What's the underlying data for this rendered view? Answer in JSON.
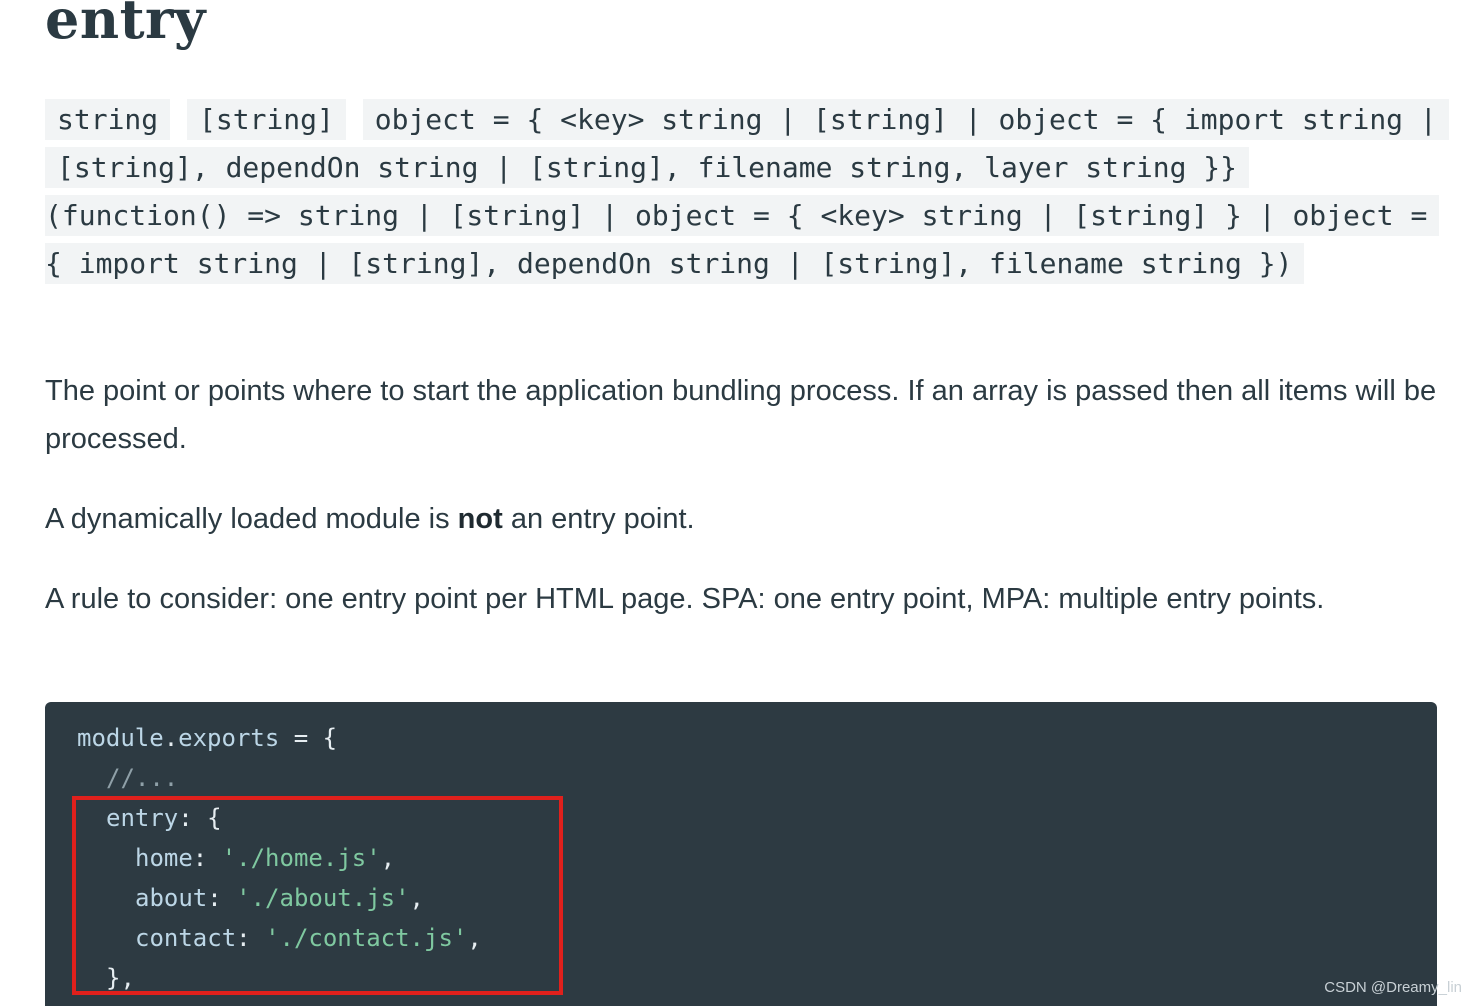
{
  "heading": "entry",
  "type_signature": {
    "t1": "string",
    "t2": "[string]",
    "t3": "object = { <key> string | [string] | object = { import string | [string], dependOn string | [string], filename string, layer string }}",
    "t4": "(function() => string | [string] | object = { <key> string | [string] } | object = { import string | [string], dependOn string | [string], filename string })"
  },
  "paragraphs": {
    "p1": "The point or points where to start the application bundling process. If an array is passed then all items will be processed.",
    "p2_before": "A dynamically loaded module is ",
    "p2_bold": "not",
    "p2_after": " an entry point.",
    "p3": "A rule to consider: one entry point per HTML page. SPA: one entry point, MPA: multiple entry points."
  },
  "code": {
    "l1_a": "module",
    "l1_b": ".",
    "l1_c": "exports",
    "l1_d": " = {",
    "l2": "//...",
    "l3_key": "entry",
    "l3_rest": ": {",
    "l4_key": "home",
    "l4_colon": ": ",
    "l4_val": "'./home.js'",
    "l4_end": ",",
    "l5_key": "about",
    "l5_colon": ": ",
    "l5_val": "'./about.js'",
    "l5_end": ",",
    "l6_key": "contact",
    "l6_colon": ": ",
    "l6_val": "'./contact.js'",
    "l6_end": ",",
    "l7": "},"
  },
  "watermark": "CSDN @Dreamy_lin",
  "colors": {
    "code_background": "#2d3a42",
    "inline_code_background": "#f2f4f5",
    "string_token": "#7fc8a0",
    "highlight_border": "#e0201c"
  }
}
